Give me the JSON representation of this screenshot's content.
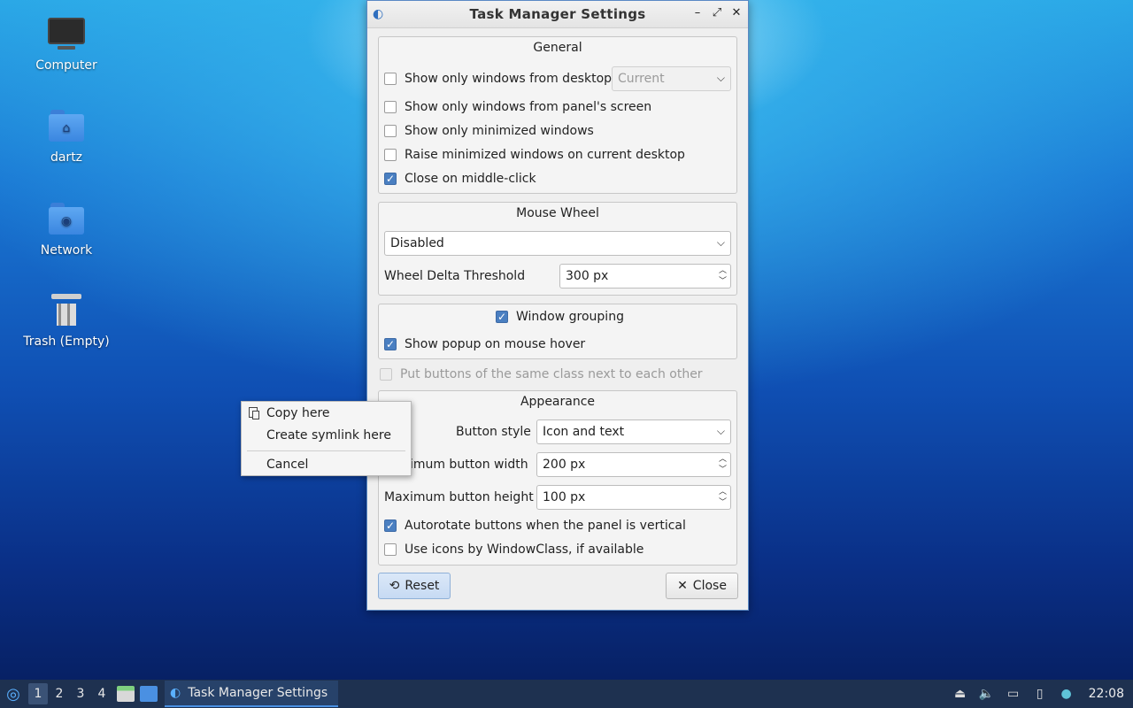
{
  "desktop": {
    "icons": [
      {
        "label": "Computer"
      },
      {
        "label": "dartz"
      },
      {
        "label": "Network"
      },
      {
        "label": "Trash (Empty)"
      }
    ]
  },
  "window": {
    "title": "Task Manager Settings",
    "controls": {
      "minimize": "–",
      "maximize": "⤢",
      "close": "✕"
    },
    "general": {
      "title": "General",
      "show_only_desktop": {
        "label": "Show only windows from desktop",
        "checked": false
      },
      "desktop_combo": {
        "value": "Current",
        "enabled": false
      },
      "show_only_panel_screen": {
        "label": "Show only windows from panel's screen",
        "checked": false
      },
      "show_only_minimized": {
        "label": "Show only minimized windows",
        "checked": false
      },
      "raise_minimized": {
        "label": "Raise minimized windows on current desktop",
        "checked": false
      },
      "close_middle_click": {
        "label": "Close on middle-click",
        "checked": true
      }
    },
    "mouse_wheel": {
      "title": "Mouse Wheel",
      "mode": "Disabled",
      "threshold_label": "Wheel Delta Threshold",
      "threshold_value": "300 px"
    },
    "grouping": {
      "window_grouping": {
        "label": "Window grouping",
        "checked": true
      },
      "show_popup": {
        "label": "Show popup on mouse hover",
        "checked": true
      }
    },
    "same_class": {
      "label": "Put buttons of the same class next to each other",
      "checked": false,
      "enabled": false
    },
    "appearance": {
      "title": "Appearance",
      "button_style_label": "Button style",
      "button_style_value": "Icon and text",
      "max_width_label": "Maximum button width",
      "max_width_value": "200 px",
      "max_height_label": "Maximum button height",
      "max_height_value": "100 px",
      "autorotate": {
        "label": "Autorotate buttons when the panel is vertical",
        "checked": true
      },
      "use_icons_wmclass": {
        "label": "Use icons by WindowClass, if available",
        "checked": false
      }
    },
    "buttons": {
      "reset": "Reset",
      "close": "Close"
    }
  },
  "context_menu": {
    "items": [
      "Copy here",
      "Create symlink here",
      "Cancel"
    ]
  },
  "taskbar": {
    "desktops": [
      "1",
      "2",
      "3",
      "4"
    ],
    "active_desktop": "1",
    "task_title": "Task Manager Settings",
    "clock": "22:08"
  }
}
